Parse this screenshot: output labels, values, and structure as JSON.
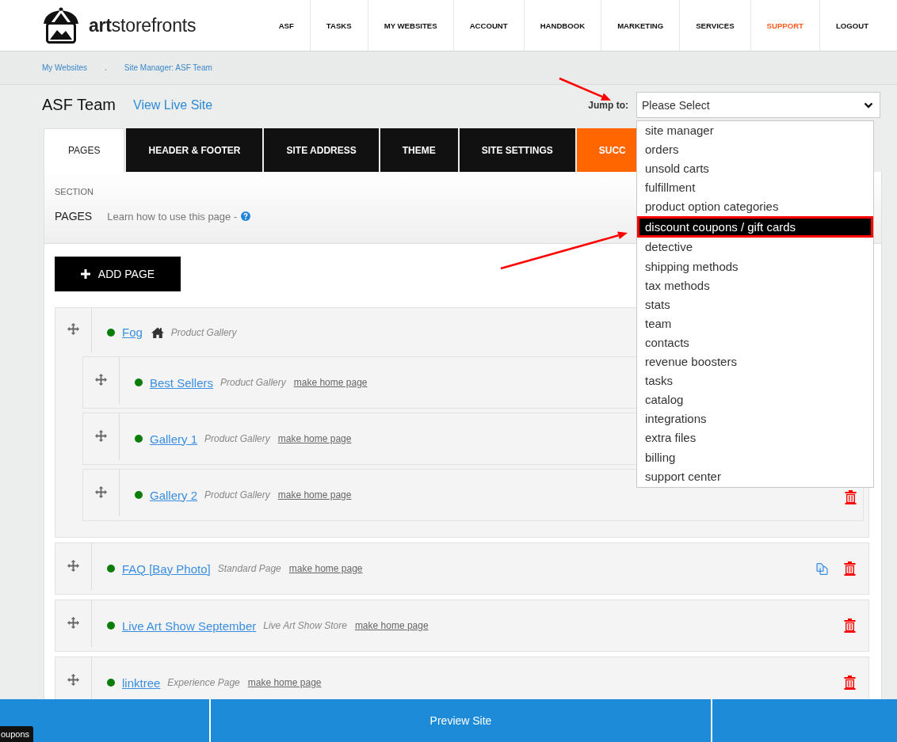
{
  "header": {
    "logo": "**art**storefronts",
    "nav": [
      {
        "label": "ASF",
        "highlighted": false
      },
      {
        "label": "TASKS",
        "highlighted": false
      },
      {
        "label": "MY WEBSITES",
        "highlighted": false
      },
      {
        "label": "ACCOUNT",
        "highlighted": false
      },
      {
        "label": "HANDBOOK",
        "highlighted": false
      },
      {
        "label": "MARKETING",
        "highlighted": false
      },
      {
        "label": "SERVICES",
        "highlighted": false
      },
      {
        "label": "SUPPORT",
        "highlighted": true
      },
      {
        "label": "LOGOUT",
        "highlighted": false
      }
    ]
  },
  "breadcrumb": {
    "items": [
      "My Websites",
      "Site Manager: ASF Team"
    ],
    "separator": "."
  },
  "site": {
    "title": "ASF Team",
    "live_link": "View Live Site"
  },
  "jump_to": {
    "label": "Jump to:",
    "value": "Please Select",
    "options": [
      {
        "label": "site manager",
        "selected": false
      },
      {
        "label": "orders",
        "selected": false
      },
      {
        "label": "unsold carts",
        "selected": false
      },
      {
        "label": "fulfillment",
        "selected": false
      },
      {
        "label": "product option categories",
        "selected": false
      },
      {
        "label": "discount coupons / gift cards",
        "selected": true
      },
      {
        "label": "detective",
        "selected": false
      },
      {
        "label": "shipping methods",
        "selected": false
      },
      {
        "label": "tax methods",
        "selected": false
      },
      {
        "label": "stats",
        "selected": false
      },
      {
        "label": "team",
        "selected": false
      },
      {
        "label": "contacts",
        "selected": false
      },
      {
        "label": "revenue boosters",
        "selected": false
      },
      {
        "label": "tasks",
        "selected": false
      },
      {
        "label": "catalog",
        "selected": false
      },
      {
        "label": "integrations",
        "selected": false
      },
      {
        "label": "extra files",
        "selected": false
      },
      {
        "label": "billing",
        "selected": false
      },
      {
        "label": "support center",
        "selected": false
      }
    ]
  },
  "tabs": [
    {
      "label": "PAGES",
      "selected": true,
      "kind": "normal"
    },
    {
      "label": "HEADER & FOOTER",
      "selected": false,
      "kind": "normal"
    },
    {
      "label": "SITE ADDRESS",
      "selected": false,
      "kind": "normal"
    },
    {
      "label": "THEME",
      "selected": false,
      "kind": "normal"
    },
    {
      "label": "SITE SETTINGS",
      "selected": false,
      "kind": "normal"
    },
    {
      "label": "SUCC",
      "selected": false,
      "kind": "accent"
    }
  ],
  "section": {
    "caption": "SECTION",
    "title": "PAGES",
    "help": "Learn how to use this page -"
  },
  "add_button": "ADD PAGE",
  "pages": [
    {
      "name": "Fog",
      "type": "Product Gallery",
      "active": true,
      "home": true,
      "children": [
        {
          "name": "Best Sellers",
          "type": "Product Gallery",
          "active": true,
          "home": false,
          "home_link": "make home page"
        },
        {
          "name": "Gallery 1",
          "type": "Product Gallery",
          "active": true,
          "home": false,
          "home_link": "make home page"
        },
        {
          "name": "Gallery 2",
          "type": "Product Gallery",
          "active": true,
          "home": false,
          "home_link": "make home page",
          "actions": [
            {
              "kind": "delete"
            }
          ]
        }
      ]
    },
    {
      "name": "FAQ [Bay Photo]",
      "type": "Standard Page",
      "active": true,
      "home": false,
      "home_link": "make home page",
      "actions": [
        {
          "kind": "copy"
        },
        {
          "kind": "delete"
        }
      ]
    },
    {
      "name": "Live Art Show September",
      "type": "Live Art Show Store",
      "active": true,
      "home": false,
      "home_link": "make home page",
      "actions": [
        {
          "kind": "delete"
        }
      ]
    },
    {
      "name": "linktree",
      "type": "Experience Page",
      "active": true,
      "home": false,
      "home_link": "make home page",
      "actions": [
        {
          "kind": "delete"
        }
      ]
    }
  ],
  "footer": {
    "preview": "Preview Site"
  },
  "tooltip": "oupons"
}
